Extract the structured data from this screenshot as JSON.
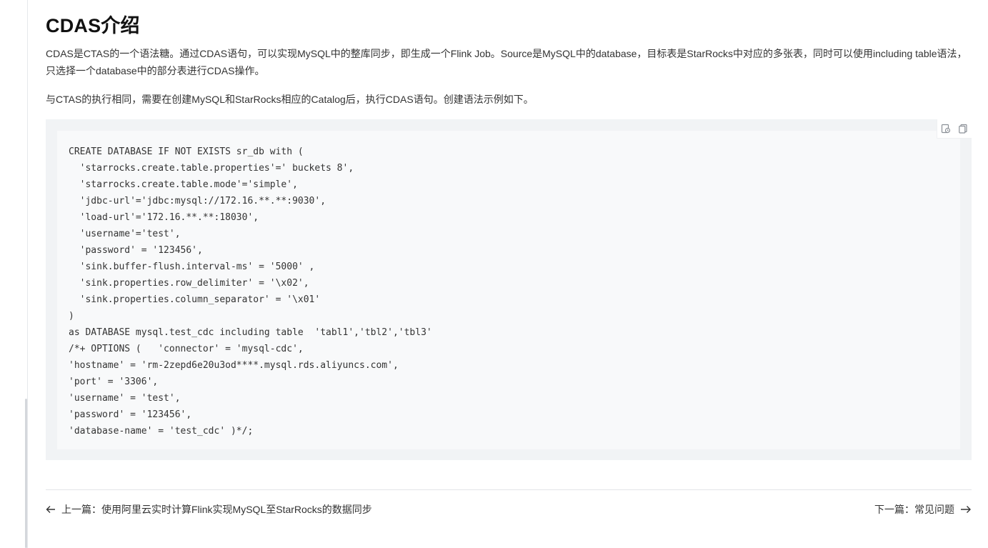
{
  "article": {
    "title": "CDAS介绍",
    "paragraph1": "CDAS是CTAS的一个语法糖。通过CDAS语句，可以实现MySQL中的整库同步，即生成一个Flink Job。Source是MySQL中的database，目标表是StarRocks中对应的多张表，同时可以使用including table语法，只选择一个database中的部分表进行CDAS操作。",
    "paragraph2": "与CTAS的执行相同，需要在创建MySQL和StarRocks相应的Catalog后，执行CDAS语句。创建语法示例如下。"
  },
  "code_block": {
    "code": "CREATE DATABASE IF NOT EXISTS sr_db with (\n  'starrocks.create.table.properties'=' buckets 8',\n  'starrocks.create.table.mode'='simple',\n  'jdbc-url'='jdbc:mysql://172.16.**.**:9030',\n  'load-url'='172.16.**.**:18030',\n  'username'='test',\n  'password' = '123456',\n  'sink.buffer-flush.interval-ms' = '5000' ,\n  'sink.properties.row_delimiter' = '\\x02',\n  'sink.properties.column_separator' = '\\x01'\n)\nas DATABASE mysql.test_cdc including table  'tabl1','tbl2','tbl3'\n/*+ OPTIONS (   'connector' = 'mysql-cdc',\n'hostname' = 'rm-2zepd6e20u3od****.mysql.rds.aliyuncs.com',\n'port' = '3306',\n'username' = 'test',\n'password' = '123456',\n'database-name' = 'test_cdc' )*/;",
    "icons": [
      "run-code-icon",
      "copy-icon"
    ]
  },
  "navigation": {
    "prev_label": "上一篇：使用阿里云实时计算Flink实现MySQL至StarRocks的数据同步",
    "next_label": "下一篇：常见问题"
  }
}
